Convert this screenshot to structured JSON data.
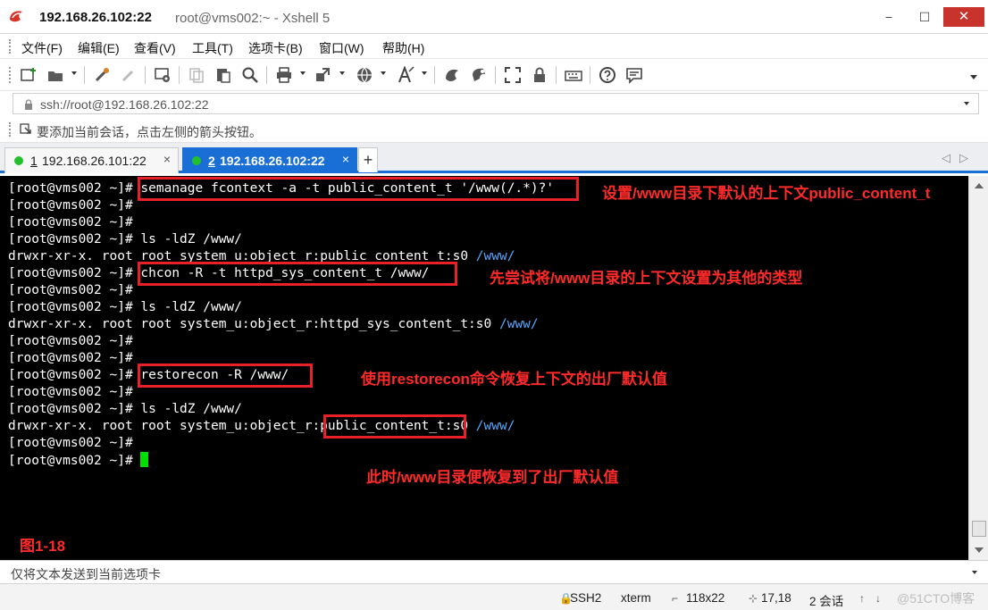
{
  "window": {
    "title": "192.168.26.102:22",
    "subtitle": "root@vms002:~ - Xshell 5",
    "minimize_glyph": "−",
    "maximize_glyph": "☐",
    "close_glyph": "✕"
  },
  "menu": [
    "文件(F)",
    "编辑(E)",
    "查看(V)",
    "工具(T)",
    "选项卡(B)",
    "窗口(W)",
    "帮助(H)"
  ],
  "toolbar_icons": [
    "new-session-icon",
    "open-folder-icon",
    "reconnect-icon",
    "disconnect-icon",
    "properties-icon",
    "copy-icon",
    "paste-icon",
    "find-icon",
    "print-icon",
    "transfer-icon",
    "globe-icon",
    "font-icon",
    "xftp-icon",
    "xmanager-icon",
    "fullscreen-icon",
    "lock-icon",
    "keyboard-icon",
    "help-icon",
    "chat-icon"
  ],
  "address": {
    "value": "ssh://root@192.168.26.102:22"
  },
  "hint": {
    "text": "要添加当前会话，点击左侧的箭头按钮。"
  },
  "tabs": [
    {
      "number": "1",
      "label": "192.168.26.101:22",
      "close": "×"
    },
    {
      "number": "2",
      "label": "192.168.26.102:22",
      "close": "×"
    }
  ],
  "tab_add": "+",
  "tab_nav": {
    "prev": "◁",
    "next": "▷"
  },
  "terminal": {
    "lines": [
      {
        "prompt": "[root@vms002 ~]# ",
        "cmd": "semanage fcontext -a -t public_content_t '/www(/.*)?'"
      },
      {
        "prompt": "[root@vms002 ~]# ",
        "cmd": ""
      },
      {
        "prompt": "[root@vms002 ~]# ",
        "cmd": ""
      },
      {
        "prompt": "[root@vms002 ~]# ",
        "cmd": "ls -ldZ /www/"
      },
      {
        "text": "drwxr-xr-x. root root system_u:object_r:public_content_t:s0 ",
        "tail": "/www/"
      },
      {
        "prompt": "[root@vms002 ~]# ",
        "cmd": "chcon -R -t httpd_sys_content_t /www/"
      },
      {
        "prompt": "[root@vms002 ~]# ",
        "cmd": ""
      },
      {
        "prompt": "[root@vms002 ~]# ",
        "cmd": "ls -ldZ /www/"
      },
      {
        "text": "drwxr-xr-x. root root system_u:object_r:httpd_sys_content_t:s0 ",
        "tail": "/www/"
      },
      {
        "prompt": "[root@vms002 ~]# ",
        "cmd": ""
      },
      {
        "prompt": "[root@vms002 ~]# ",
        "cmd": ""
      },
      {
        "prompt": "[root@vms002 ~]# ",
        "cmd": "restorecon -R /www/"
      },
      {
        "prompt": "[root@vms002 ~]# ",
        "cmd": ""
      },
      {
        "prompt": "[root@vms002 ~]# ",
        "cmd": "ls -ldZ /www/"
      },
      {
        "text": "drwxr-xr-x. root root system_u:object_r:public_content_t:s0 ",
        "tail": "/www/"
      },
      {
        "prompt": "[root@vms002 ~]# ",
        "cmd": ""
      },
      {
        "prompt": "[root@vms002 ~]# ",
        "cmd": ""
      }
    ]
  },
  "annotations": [
    "设置/www目录下默认的上下文public_content_t",
    "先尝试将/www目录的上下文设置为其他的类型",
    "使用restorecon命令恢复上下文的出厂默认值",
    "此时/www目录便恢复到了出厂默认值"
  ],
  "figure_label": "图1-18",
  "send_bar": {
    "text": "仅将文本发送到当前选项卡"
  },
  "status": {
    "protocol": "SSH2",
    "terminal_type": "xterm",
    "size": "118x22",
    "cursor_pos": "17,18",
    "sessions": "2 会话",
    "watermark": "@51CTO博客"
  },
  "colors": {
    "accent": "#1a6fd6",
    "annotation": "#e8202a",
    "terminal_bg": "#000000",
    "dir_highlight": "#5aa7ff",
    "cursor": "#00e000",
    "status_dot": "#22c02c"
  }
}
